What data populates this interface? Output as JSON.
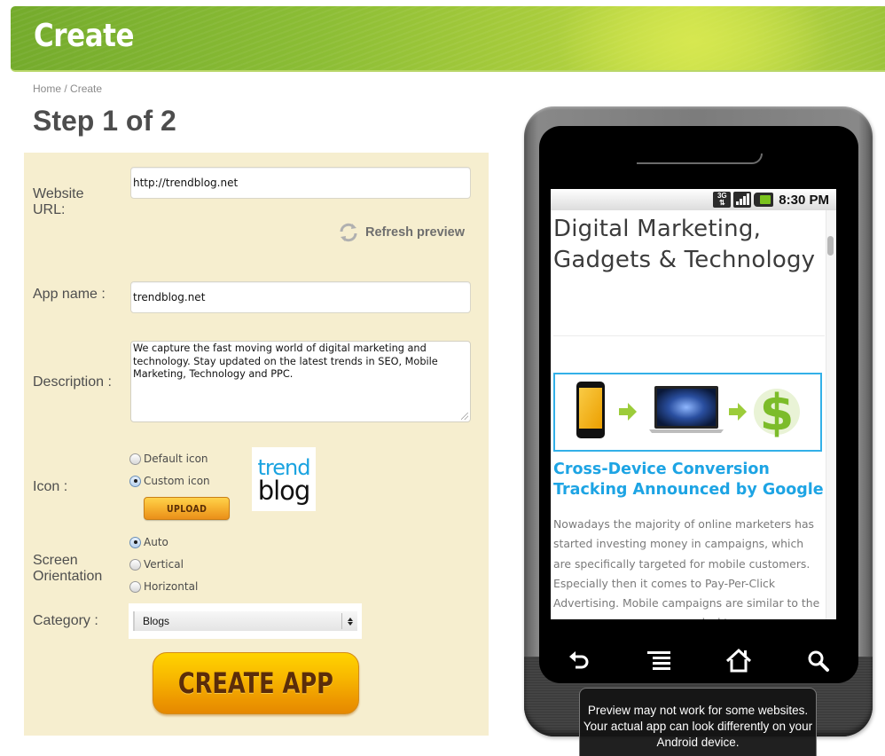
{
  "header": {
    "title": "Create"
  },
  "breadcrumb": {
    "items": [
      "Home",
      "Create"
    ],
    "separator": " / "
  },
  "page": {
    "step_title": "Step 1 of 2"
  },
  "form": {
    "website_url": {
      "label": "Website URL:",
      "value": "http://trendblog.net"
    },
    "refresh_preview": {
      "label": "Refresh preview",
      "icon": "refresh-icon"
    },
    "app_name": {
      "label": "App name :",
      "value": "trendblog.net"
    },
    "description": {
      "label": "Description :",
      "value": "We capture the fast moving world of digital marketing and technology. Stay updated on the latest trends in SEO, Mobile Marketing, Technology and PPC."
    },
    "icon": {
      "label": "Icon :",
      "options": [
        {
          "label": "Default icon",
          "checked": false
        },
        {
          "label": "Custom icon",
          "checked": true
        }
      ],
      "upload_label": "UPLOAD",
      "logo": {
        "line1": "trend",
        "line2": "blog"
      }
    },
    "screen_orientation": {
      "label": "Screen Orientation",
      "options": [
        {
          "label": "Auto",
          "checked": true
        },
        {
          "label": "Vertical",
          "checked": false
        },
        {
          "label": "Horizontal",
          "checked": false
        }
      ]
    },
    "category": {
      "label": "Category :",
      "selected": "Blogs"
    },
    "create_button": "CREATE APP"
  },
  "phone_preview": {
    "status_bar": {
      "network": "3G",
      "time": "8:30 PM"
    },
    "site_title": "Digital Marketing, Gadgets & Technology",
    "article_title": "Cross-Device Conversion Tracking Announced by Google",
    "article_body": "Nowadays the majority of online marketers has started investing money in campaigns, which are specifically targeted for mobile customers. Especially then it comes to Pay-Per-Click Advertising. Mobile campaigns are similar to the ones you can see on your desktop",
    "nav_buttons": [
      "back-icon",
      "menu-icon",
      "home-icon",
      "search-icon"
    ],
    "notice": "Preview may not work for  some websites. Your actual app can look differently on your Android device."
  },
  "colors": {
    "banner_green": "#8bbd35",
    "form_bg": "#f6eecf",
    "button_orange": "#f8b800",
    "link_blue": "#1da4e4"
  }
}
